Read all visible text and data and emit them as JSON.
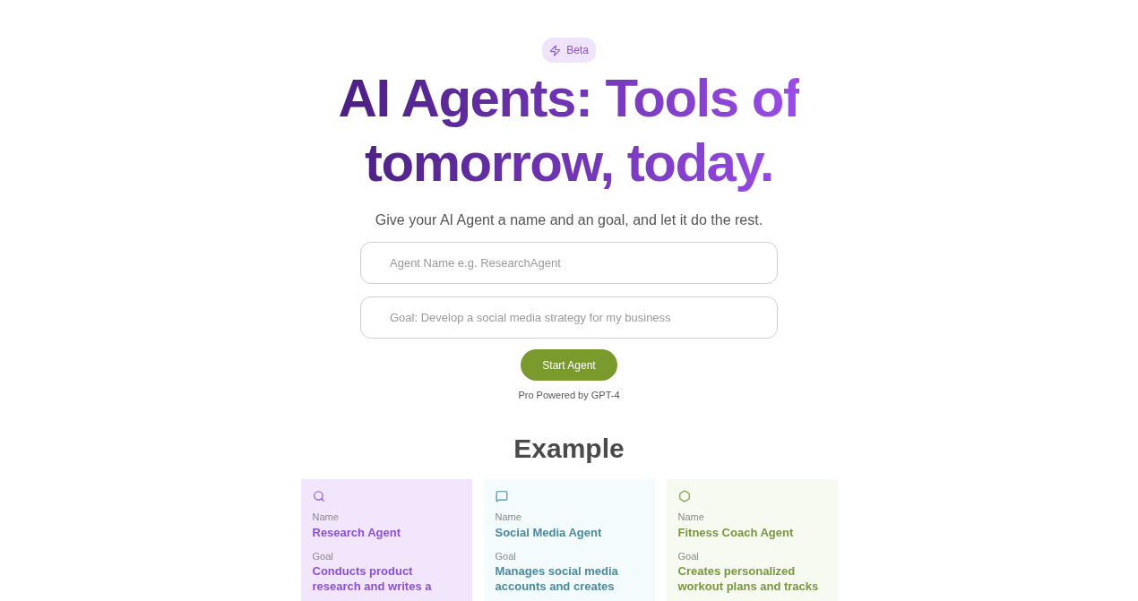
{
  "badge": {
    "label": "Beta"
  },
  "headline": {
    "line1": "AI Agents: Tools of",
    "line2": "tomorrow, today."
  },
  "subtitle": "Give your AI Agent a name and an goal, and let it do the rest.",
  "fields": [
    {
      "placeholder": "Agent Name e.g. ResearchAgent"
    },
    {
      "placeholder": "Goal: Develop a social media strategy for my business"
    }
  ],
  "start_button": "Start Agent",
  "powered_by": "Pro Powered by GPT-4",
  "examples": {
    "title": "Example",
    "cards": [
      {
        "kind": "search",
        "color": "#8b4fd6",
        "name_label": "Name",
        "name": "Research Agent",
        "goal_label": "Goal",
        "goal": "Conducts product research and writes a"
      },
      {
        "kind": "chat",
        "color": "#4a8a9a",
        "name_label": "Name",
        "name": "Social Media Agent",
        "goal_label": "Goal",
        "goal": "Manages social media accounts and creates"
      },
      {
        "kind": "hexagon",
        "color": "#7a9640",
        "name_label": "Name",
        "name": "Fitness Coach Agent",
        "goal_label": "Goal",
        "goal": "Creates personalized workout plans and tracks"
      }
    ]
  }
}
